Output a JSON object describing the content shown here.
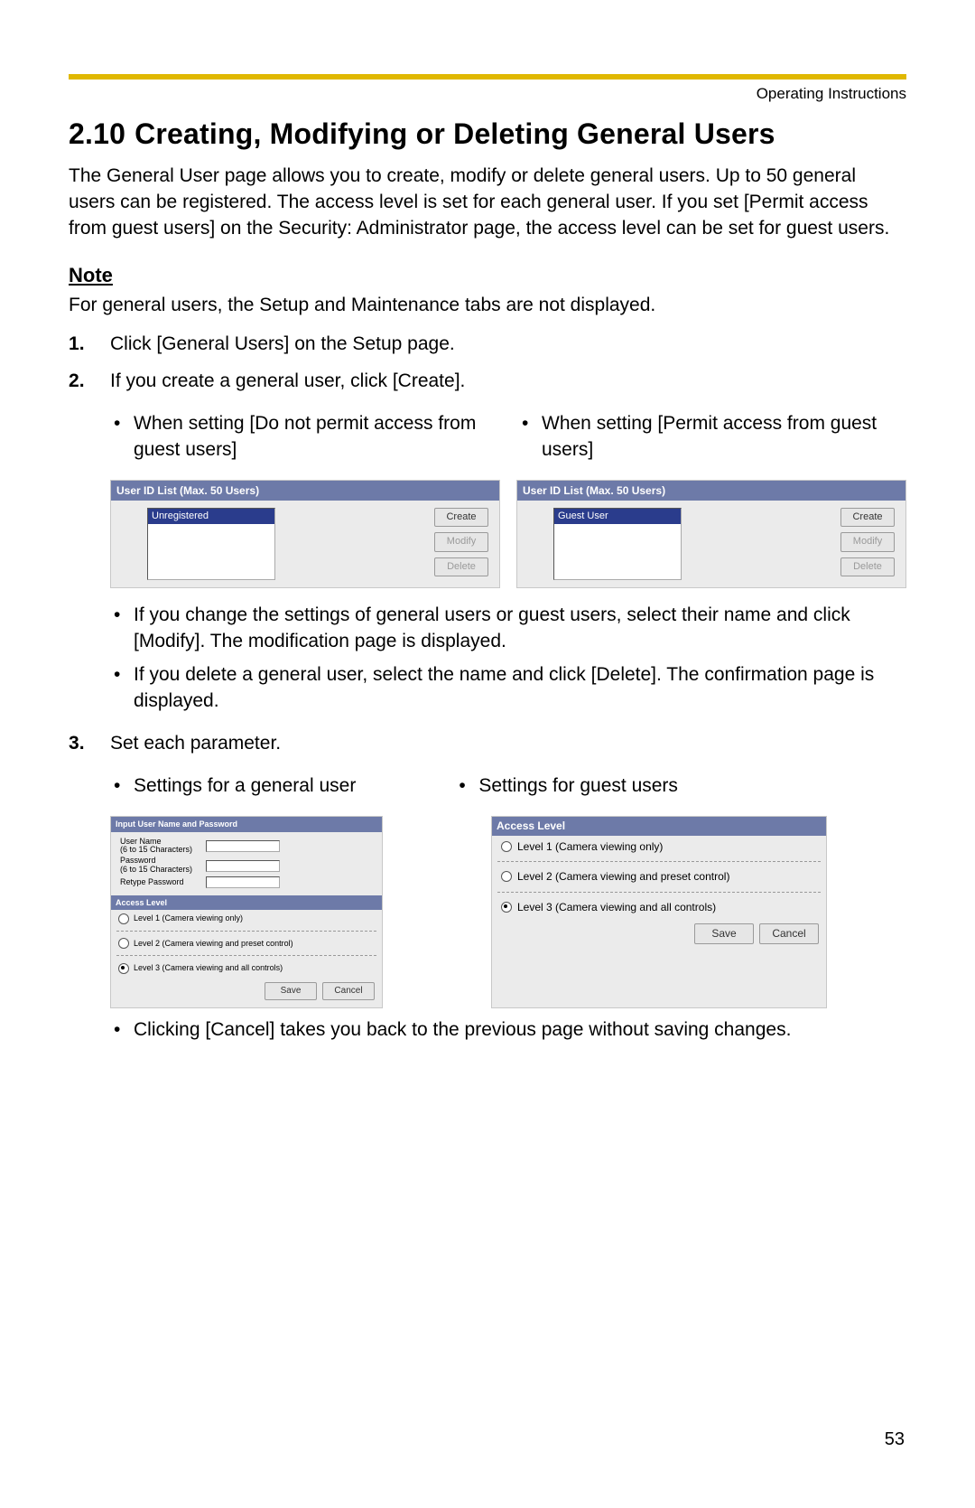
{
  "header": {
    "right": "Operating Instructions"
  },
  "section": {
    "number": "2.10",
    "title": "Creating, Modifying or Deleting General Users"
  },
  "intro": "The General User page allows you to create, modify or delete general users. Up to 50 general users can be registered. The access level is set for each general user. If you set [Permit access from guest users] on the Security: Administrator page, the access level can be set for guest users.",
  "note": {
    "heading": "Note",
    "body": "For general users, the Setup and Maintenance tabs are not displayed."
  },
  "steps": {
    "s1": "Click [General Users] on the Setup page.",
    "s2": "If you create a general user, click [Create].",
    "s2_cols": {
      "left": "When setting [Do not permit access from guest users]",
      "right": "When setting [Permit access from guest users]"
    },
    "s2_shots": {
      "title": "User ID List (Max. 50 Users)",
      "leftItem": "Unregistered",
      "rightItem": "Guest User",
      "btnCreate": "Create",
      "btnModify": "Modify",
      "btnDelete": "Delete"
    },
    "s2_subs": {
      "a": "If you change the settings of general users or guest users, select their name and click [Modify]. The modification page is displayed.",
      "b": "If you delete a general user, select the name and click [Delete]. The confirmation page is displayed."
    },
    "s3": "Set each parameter.",
    "s3_cols": {
      "left": "Settings for a general user",
      "right": "Settings for guest users"
    },
    "s3_shotA": {
      "bar1": "Input User Name and Password",
      "userName": "User Name",
      "userNameHint": "(6 to 15 Characters)",
      "password": "Password",
      "passwordHint": "(6 to 15 Characters)",
      "retype": "Retype Password",
      "bar2": "Access Level",
      "lvl1": "Level 1 (Camera viewing only)",
      "lvl2": "Level 2 (Camera viewing and preset control)",
      "lvl3": "Level 3 (Camera viewing and all controls)",
      "save": "Save",
      "cancel": "Cancel"
    },
    "s3_shotB": {
      "bar": "Access Level",
      "lvl1": "Level 1 (Camera viewing only)",
      "lvl2": "Level 2 (Camera viewing and preset control)",
      "lvl3": "Level 3 (Camera viewing and all controls)",
      "save": "Save",
      "cancel": "Cancel"
    },
    "s3_sub": "Clicking [Cancel] takes you back to the previous page without saving changes."
  },
  "pageNumber": "53"
}
